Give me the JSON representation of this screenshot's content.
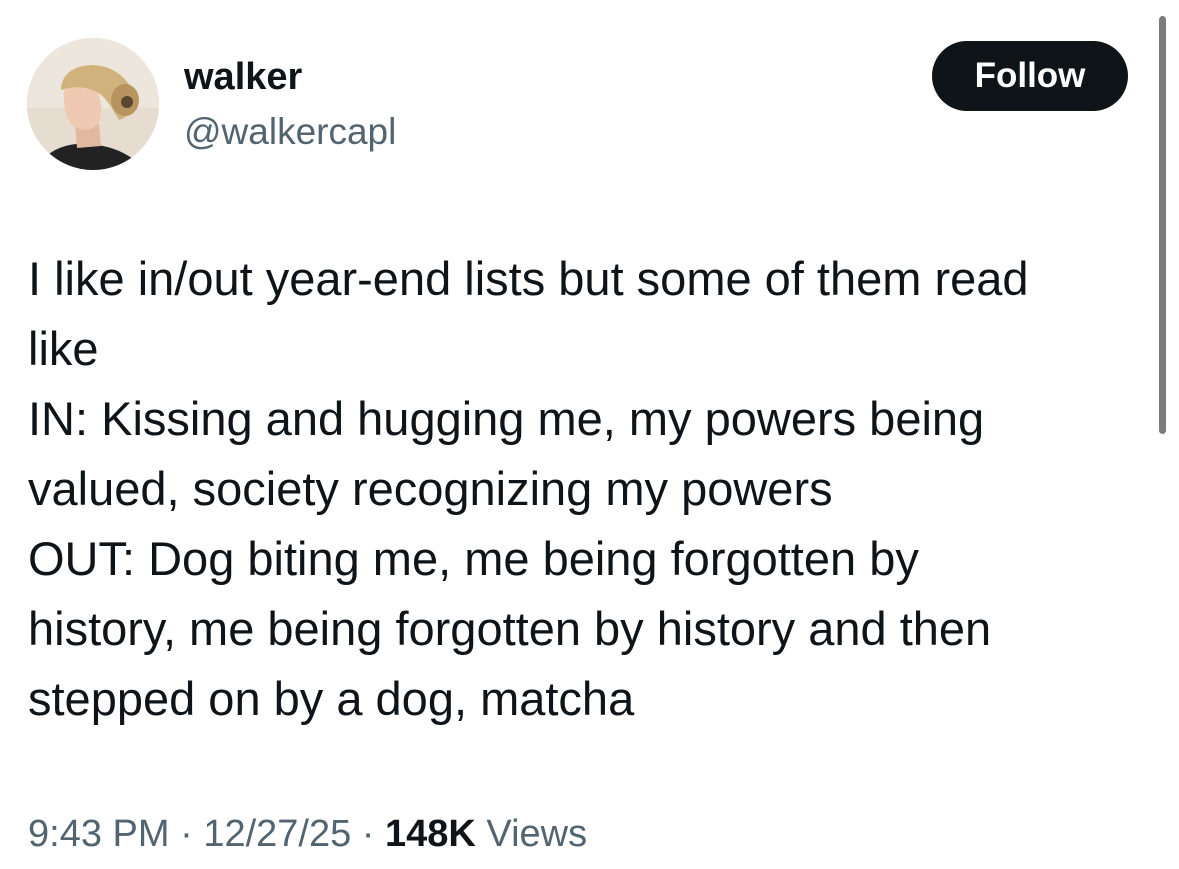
{
  "author": {
    "display_name": "walker",
    "handle": "@walkercapl"
  },
  "follow_button": {
    "label": "Follow"
  },
  "tweet": {
    "lines": [
      "I like in/out year-end lists but some of them read",
      "like",
      "IN: Kissing and hugging me, my powers being",
      "valued, society recognizing my powers",
      "OUT: Dog biting me, me being forgotten by",
      "history, me being forgotten by history and then",
      "stepped on by a dog, matcha"
    ]
  },
  "meta": {
    "time": "9:43 PM",
    "separator": "·",
    "date": "12/27/25",
    "views_count": "148K",
    "views_label": "Views"
  },
  "colors": {
    "text_primary": "#0f1419",
    "text_secondary": "#536471",
    "button_bg": "#0f1419",
    "button_text": "#ffffff"
  }
}
